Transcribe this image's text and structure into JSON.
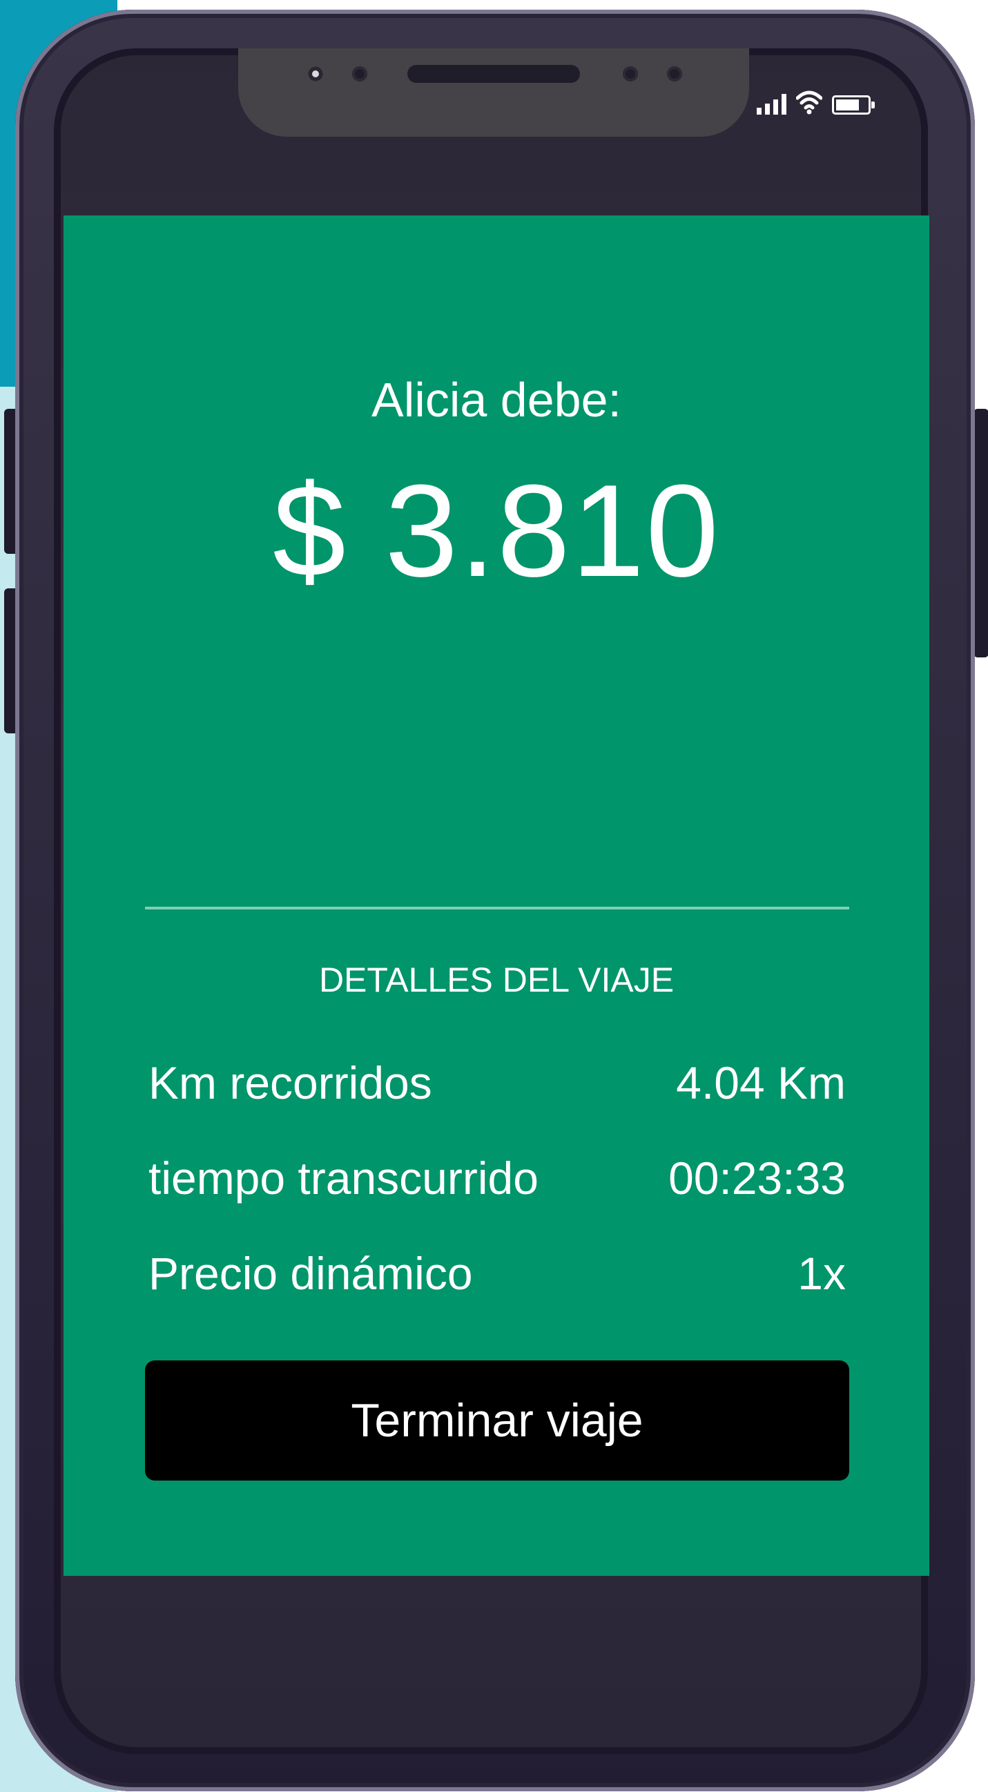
{
  "status_bar": {
    "signal_icon": "signal-bars-icon",
    "wifi_icon": "wifi-icon",
    "battery_icon": "battery-icon",
    "battery_level": 0.75
  },
  "payment": {
    "owes_label": "Alicia debe:",
    "amount": "$ 3.810"
  },
  "trip_details": {
    "title": "DETALLES DEL VIAJE",
    "rows": [
      {
        "label": "Km recorridos",
        "value": "4.04 Km"
      },
      {
        "label": "tiempo transcurrido",
        "value": "00:23:33"
      },
      {
        "label": "Precio dinámico",
        "value": "1x"
      }
    ]
  },
  "actions": {
    "end_trip_label": "Terminar viaje"
  },
  "colors": {
    "screen_green": "#00956a",
    "button_black": "#000000",
    "phone_frame": "#2b2736",
    "accent_teal": "#0b9cb8"
  }
}
